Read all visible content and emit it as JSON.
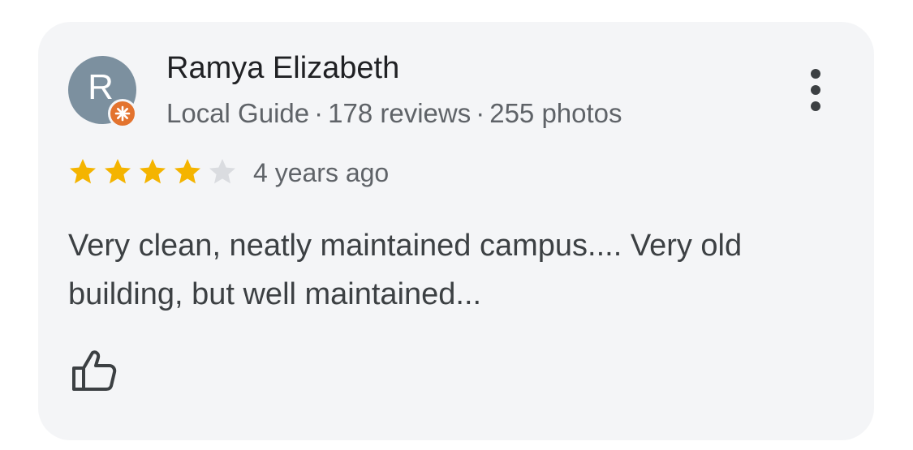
{
  "review": {
    "avatar_letter": "R",
    "avatar_color": "#7c909f",
    "badge_color": "#e3732e",
    "badge_icon": "local-guide-star-icon",
    "author": "Ramya Elizabeth",
    "role": "Local Guide",
    "separator": "·",
    "reviews": "178 reviews",
    "photos": "255 photos",
    "rating": 4,
    "rating_max": 5,
    "star_color": "#f4b400",
    "star_empty_color": "#dadce0",
    "time": "4 years ago",
    "text_lines": [
      "Very clean, neatly maintained campus.... Very old",
      "building, but well maintained..."
    ],
    "more_icon": "more-vertical-icon",
    "like_icon": "thumbs-up-icon"
  }
}
